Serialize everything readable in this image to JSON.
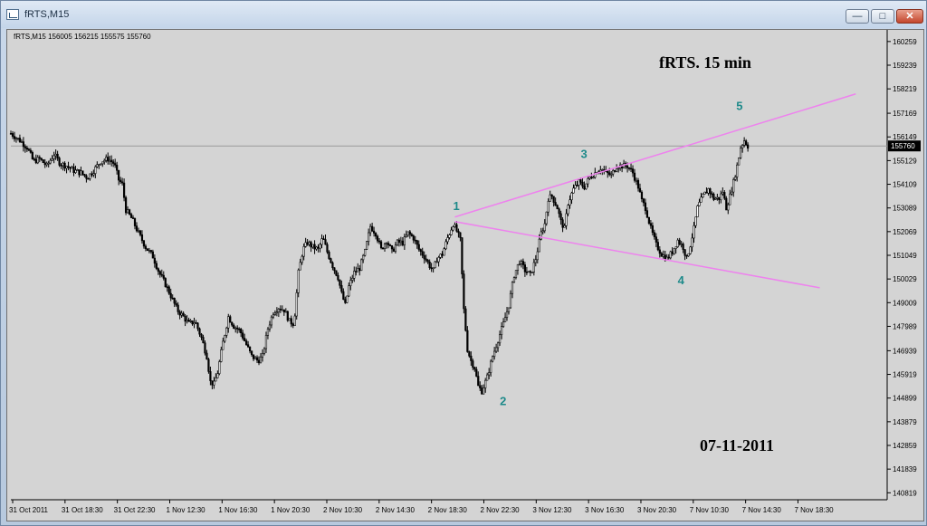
{
  "window": {
    "title": "fRTS,M15",
    "minimize_glyph": "—",
    "maximize_glyph": "□",
    "close_glyph": "✕"
  },
  "chart_data": {
    "type": "candlestick",
    "header": "fRTS,M15  156005 156215 155575 155760",
    "title": "fRTS. 15 min",
    "date_label": "07-11-2011",
    "current_price_label": "155760",
    "current_price": 155760,
    "ylim": [
      140519,
      160760
    ],
    "y_ticks": [
      160259,
      159239,
      158219,
      157169,
      156149,
      155129,
      154109,
      153089,
      152069,
      151049,
      150029,
      149009,
      147989,
      146939,
      145919,
      144899,
      143879,
      142859,
      141839,
      140819
    ],
    "x_ticks": [
      "31 Oct 2011",
      "31 Oct 18:30",
      "31 Oct 22:30",
      "1 Nov 12:30",
      "1 Nov 16:30",
      "1 Nov 20:30",
      "2 Nov 10:30",
      "2 Nov 14:30",
      "2 Nov 18:30",
      "2 Nov 22:30",
      "3 Nov 12:30",
      "3 Nov 16:30",
      "3 Nov 20:30",
      "7 Nov 10:30",
      "7 Nov 14:30",
      "7 Nov 18:30"
    ],
    "wave_labels": [
      {
        "text": "1",
        "time": 492,
        "price": 153000
      },
      {
        "text": "2",
        "time": 544,
        "price": 144600
      },
      {
        "text": "3",
        "time": 634,
        "price": 155250
      },
      {
        "text": "4",
        "time": 742,
        "price": 149800
      },
      {
        "text": "5",
        "time": 807,
        "price": 157300
      }
    ],
    "trendlines": [
      {
        "from": {
          "time": 494,
          "price": 152700
        },
        "to": {
          "time": 940,
          "price": 158000
        },
        "color": "#ee82ee"
      },
      {
        "from": {
          "time": 494,
          "price": 152500
        },
        "to": {
          "time": 900,
          "price": 149650
        },
        "color": "#ee82ee"
      }
    ],
    "close_path": [
      [
        0,
        156300
      ],
      [
        10,
        156000
      ],
      [
        18,
        155700
      ],
      [
        25,
        155100
      ],
      [
        32,
        155200
      ],
      [
        40,
        154900
      ],
      [
        48,
        155400
      ],
      [
        55,
        155000
      ],
      [
        62,
        154900
      ],
      [
        70,
        154700
      ],
      [
        78,
        154600
      ],
      [
        85,
        154400
      ],
      [
        92,
        154700
      ],
      [
        100,
        155100
      ],
      [
        108,
        155200
      ],
      [
        115,
        155000
      ],
      [
        120,
        154300
      ],
      [
        124,
        154100
      ],
      [
        128,
        153000
      ],
      [
        135,
        152600
      ],
      [
        142,
        152000
      ],
      [
        150,
        151400
      ],
      [
        158,
        151000
      ],
      [
        165,
        150300
      ],
      [
        172,
        149800
      ],
      [
        178,
        149300
      ],
      [
        185,
        148700
      ],
      [
        192,
        148400
      ],
      [
        198,
        148100
      ],
      [
        205,
        148200
      ],
      [
        212,
        147500
      ],
      [
        218,
        146700
      ],
      [
        222,
        145600
      ],
      [
        226,
        145500
      ],
      [
        230,
        146000
      ],
      [
        236,
        147300
      ],
      [
        242,
        148400
      ],
      [
        248,
        148000
      ],
      [
        255,
        147800
      ],
      [
        262,
        147200
      ],
      [
        268,
        146700
      ],
      [
        275,
        146500
      ],
      [
        280,
        146700
      ],
      [
        286,
        147900
      ],
      [
        292,
        148600
      ],
      [
        298,
        148800
      ],
      [
        304,
        148700
      ],
      [
        310,
        148200
      ],
      [
        315,
        148100
      ],
      [
        320,
        150300
      ],
      [
        325,
        151300
      ],
      [
        330,
        151600
      ],
      [
        336,
        151400
      ],
      [
        342,
        151300
      ],
      [
        347,
        151800
      ],
      [
        352,
        151200
      ],
      [
        358,
        150600
      ],
      [
        364,
        150100
      ],
      [
        368,
        149400
      ],
      [
        372,
        148900
      ],
      [
        376,
        149700
      ],
      [
        382,
        150300
      ],
      [
        388,
        150500
      ],
      [
        394,
        151200
      ],
      [
        400,
        152300
      ],
      [
        406,
        152000
      ],
      [
        412,
        151300
      ],
      [
        418,
        151700
      ],
      [
        424,
        151200
      ],
      [
        430,
        151600
      ],
      [
        436,
        151600
      ],
      [
        442,
        152000
      ],
      [
        448,
        151800
      ],
      [
        454,
        151300
      ],
      [
        460,
        151000
      ],
      [
        466,
        150600
      ],
      [
        470,
        150400
      ],
      [
        474,
        150900
      ],
      [
        480,
        151100
      ],
      [
        486,
        151800
      ],
      [
        492,
        152400
      ],
      [
        496,
        152100
      ],
      [
        500,
        151700
      ],
      [
        504,
        148700
      ],
      [
        508,
        147000
      ],
      [
        512,
        146500
      ],
      [
        516,
        146200
      ],
      [
        520,
        145400
      ],
      [
        524,
        145200
      ],
      [
        530,
        145800
      ],
      [
        536,
        146700
      ],
      [
        542,
        147400
      ],
      [
        548,
        148100
      ],
      [
        554,
        148900
      ],
      [
        560,
        150200
      ],
      [
        566,
        150800
      ],
      [
        572,
        150400
      ],
      [
        578,
        150200
      ],
      [
        584,
        150900
      ],
      [
        590,
        152000
      ],
      [
        594,
        152400
      ],
      [
        598,
        153500
      ],
      [
        602,
        153600
      ],
      [
        608,
        153100
      ],
      [
        612,
        152500
      ],
      [
        616,
        152200
      ],
      [
        620,
        153300
      ],
      [
        626,
        153900
      ],
      [
        632,
        154200
      ],
      [
        638,
        154000
      ],
      [
        644,
        154400
      ],
      [
        650,
        154600
      ],
      [
        656,
        154800
      ],
      [
        662,
        154600
      ],
      [
        668,
        154500
      ],
      [
        674,
        154900
      ],
      [
        680,
        154900
      ],
      [
        686,
        154900
      ],
      [
        692,
        154600
      ],
      [
        698,
        154000
      ],
      [
        702,
        153400
      ],
      [
        706,
        153100
      ],
      [
        712,
        152200
      ],
      [
        718,
        151500
      ],
      [
        724,
        151100
      ],
      [
        730,
        150900
      ],
      [
        736,
        151200
      ],
      [
        742,
        151700
      ],
      [
        748,
        151400
      ],
      [
        752,
        150900
      ],
      [
        756,
        151500
      ],
      [
        760,
        152200
      ],
      [
        764,
        153100
      ],
      [
        770,
        153600
      ],
      [
        776,
        153900
      ],
      [
        782,
        153500
      ],
      [
        788,
        153500
      ],
      [
        792,
        153800
      ],
      [
        796,
        153100
      ],
      [
        800,
        153600
      ],
      [
        804,
        154200
      ],
      [
        808,
        154900
      ],
      [
        812,
        155700
      ],
      [
        816,
        156000
      ],
      [
        820,
        155760
      ]
    ]
  }
}
